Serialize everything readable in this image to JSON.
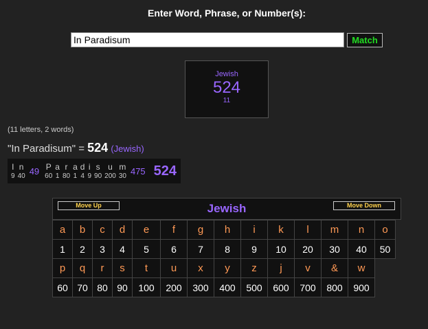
{
  "prompt": "Enter Word, Phrase, or Number(s):",
  "input": {
    "value": "In Paradisum"
  },
  "match_label": "Match",
  "cipher_box": {
    "name": "Jewish",
    "total": "524",
    "count": "11"
  },
  "stats": "(11 letters, 2 words)",
  "summary": {
    "phrase": "\"In Paradisum\" = ",
    "value": "524",
    "cipher": "(Jewish)"
  },
  "breakdown": {
    "words": [
      {
        "letters": [
          {
            "ch": "I",
            "val": "9"
          },
          {
            "ch": "n",
            "val": "40"
          }
        ],
        "total": "49"
      },
      {
        "letters": [
          {
            "ch": "P",
            "val": "60"
          },
          {
            "ch": "a",
            "val": "1"
          },
          {
            "ch": "r",
            "val": "80"
          },
          {
            "ch": "a",
            "val": "1"
          },
          {
            "ch": "d",
            "val": "4"
          },
          {
            "ch": "i",
            "val": "9"
          },
          {
            "ch": "s",
            "val": "90"
          },
          {
            "ch": "u",
            "val": "200"
          },
          {
            "ch": "m",
            "val": "30"
          }
        ],
        "total": "475"
      }
    ],
    "grand_total": "524"
  },
  "chart": {
    "move_up": "Move Up",
    "move_down": "Move Down",
    "title": "Jewish",
    "rows": [
      {
        "letters": [
          "a",
          "b",
          "c",
          "d",
          "e",
          "f",
          "g",
          "h",
          "i",
          "k",
          "l",
          "m",
          "n",
          "o"
        ],
        "values": [
          "1",
          "2",
          "3",
          "4",
          "5",
          "6",
          "7",
          "8",
          "9",
          "10",
          "20",
          "30",
          "40",
          "50"
        ]
      },
      {
        "letters": [
          "p",
          "q",
          "r",
          "s",
          "t",
          "u",
          "x",
          "y",
          "z",
          "j",
          "v",
          "&",
          "w"
        ],
        "values": [
          "60",
          "70",
          "80",
          "90",
          "100",
          "200",
          "300",
          "400",
          "500",
          "600",
          "700",
          "800",
          "900"
        ]
      }
    ]
  },
  "colors": {
    "background": "#222222",
    "cipher": "#9966ff",
    "match_text": "#22dd22",
    "letter": "#ff9955",
    "move_text": "#ffd24d"
  }
}
